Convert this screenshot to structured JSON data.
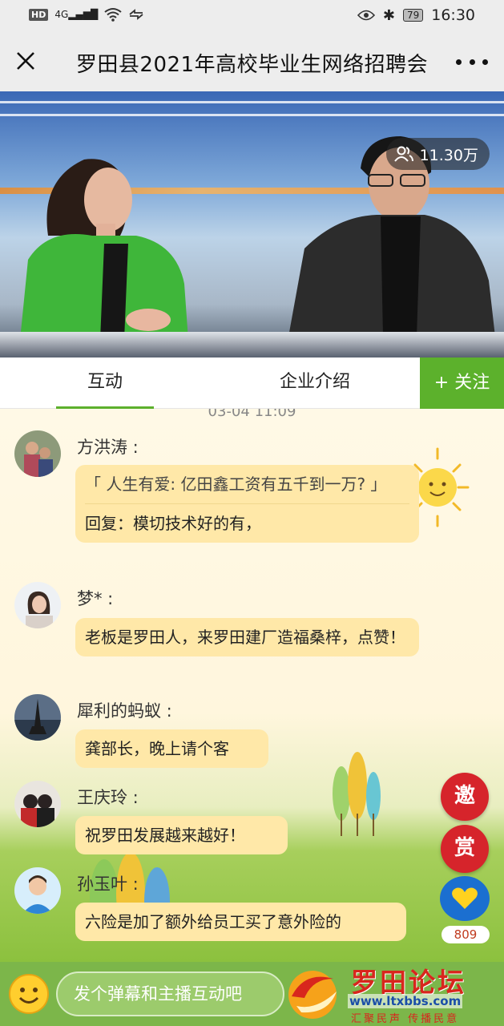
{
  "status_bar": {
    "network": "4G",
    "hd": "HD",
    "battery": "79",
    "time": "16:30"
  },
  "header": {
    "title": "罗田县2021年高校毕业生网络招聘会"
  },
  "video": {
    "viewers": "11.30万"
  },
  "tabs": {
    "chat": "互动",
    "company": "企业介绍",
    "follow": "+ 关注"
  },
  "chat": {
    "timestamp": "03-04 11:09",
    "messages": [
      {
        "nick": "方洪涛 :",
        "quote": "「 人生有爱: 亿田鑫工资有五千到一万? 」",
        "text": "回复：模切技术好的有，"
      },
      {
        "nick": "梦* :",
        "text": "老板是罗田人，来罗田建厂造福桑梓，点赞！"
      },
      {
        "nick": "犀利的蚂蚁 :",
        "text": "龚部长，晚上请个客"
      },
      {
        "nick": "王庆玲 :",
        "text": "祝罗田发展越来越好！"
      },
      {
        "nick": "孙玉叶 :",
        "text": "六险是加了额外给员工买了意外险的"
      }
    ]
  },
  "side": {
    "invite": "邀",
    "reward": "赏",
    "likes": "809"
  },
  "bottom": {
    "input_placeholder": "发个弹幕和主播互动吧"
  },
  "watermark": {
    "name": "罗田论坛",
    "url": "www.ltxbbs.com",
    "slogan": "汇聚民声 传播民意"
  },
  "colors": {
    "accent_green": "#5cb12c",
    "bubble": "#ffe8a8",
    "invite_red": "#d6242b",
    "like_blue": "#1b6fd0"
  }
}
